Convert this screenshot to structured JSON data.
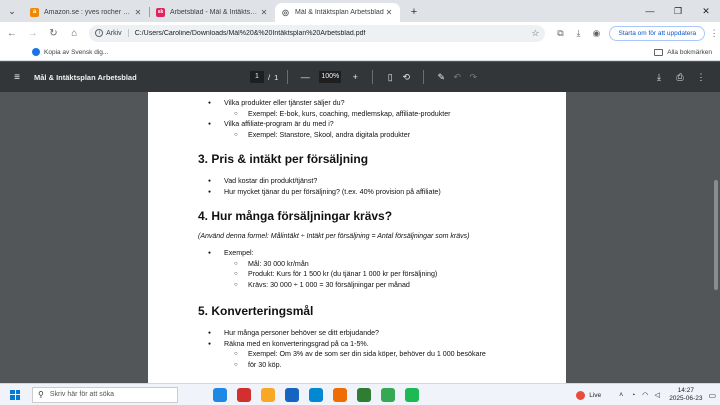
{
  "browser": {
    "tabs": [
      {
        "title": "Amazon.se : yves rocher make",
        "favicon_color": "#f08804",
        "favicon_glyph": "a",
        "active": false
      },
      {
        "title": "Arbetsblad - Mål & Intäktsplan",
        "favicon_color": "#e0245e",
        "favicon_glyph": "sk",
        "active": false
      },
      {
        "title": "Mål & Intäktsplan Arbetsblad",
        "favicon_color": "#5f6368",
        "favicon_glyph": "◎",
        "active": true
      }
    ],
    "address": {
      "chip_label": "Arkiv",
      "url": "C:/Users/Caroline/Downloads/Mål%20&%20Intäktsplan%20Arbetsblad.pdf"
    },
    "update_button": "Starta om för att uppdatera",
    "bookmarks": {
      "item": "Kopia av Svensk dig...",
      "all": "Alla bokmärken"
    }
  },
  "pdf": {
    "title": "Mål & Intäktsplan Arbetsblad",
    "page_current": "1",
    "page_sep": "/",
    "page_total": "1",
    "zoom": "100%"
  },
  "doc": {
    "s2_items": [
      {
        "text": "Vilka produkter eller tjänster säljer du?",
        "sub": [
          "Exempel: E-bok, kurs, coaching, medlemskap, affiliate-produkter"
        ]
      },
      {
        "text": "Vilka affiliate-program är du med i?",
        "sub": [
          "Exempel: Stanstore, Skool, andra digitala produkter"
        ]
      }
    ],
    "s3_heading": "3. Pris & intäkt per försäljning",
    "s3_items": [
      "Vad kostar din produkt/tjänst?",
      "Hur mycket tjänar du per försäljning? (t.ex. 40% provision på affiliate)"
    ],
    "s4_heading": "4. Hur många försäljningar krävs?",
    "s4_formula": "(Använd denna formel: Målintäkt ÷ Intäkt per försäljning = Antal försäljningar som krävs)",
    "s4_example_label": "Exempel:",
    "s4_example_items": [
      "Mål: 30 000 kr/mån",
      "Produkt: Kurs för 1 500 kr (du tjänar 1 000 kr per försäljning)",
      "Krävs: 30 000 ÷ 1 000 = 30 försäljningar per månad"
    ],
    "s5_heading": "5. Konverteringsmål",
    "s5_items": [
      "Hur många personer behöver se ditt erbjudande?",
      "Räkna med en konverteringsgrad på ca 1-5%."
    ],
    "s5_sub": [
      "Exempel: Om 3% av de som ser din sida köper, behöver du 1 000 besökare",
      "för 30 köp."
    ]
  },
  "taskbar": {
    "search_placeholder": "Skriv här för att söka",
    "live_label": "Live",
    "time": "14:27",
    "date": "2025-06-23",
    "app_colors": [
      "#1e88e5",
      "#d32f2f",
      "#f9a825",
      "#1565c0",
      "#0288d1",
      "#ef6c00",
      "#2e7d32",
      "#34a853",
      "#1db954"
    ]
  }
}
